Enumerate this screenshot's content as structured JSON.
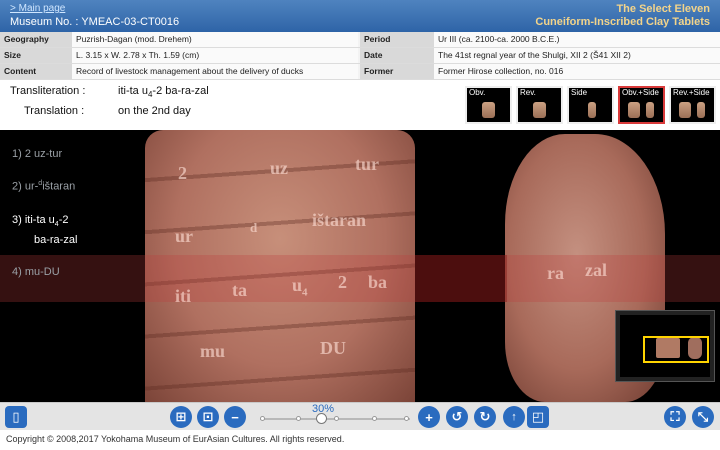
{
  "header": {
    "back_link": "> Main page",
    "museum_no": "Museum No. : YMEAC-03-CT0016",
    "title_line1": "The Select Eleven",
    "title_line2": "Cuneiform-Inscribed Clay Tablets"
  },
  "info": {
    "geography_label": "Geography",
    "geography_value": "Puzrish-Dagan (mod. Drehem)",
    "size_label": "Size",
    "size_value": "L. 3.15 x W. 2.78 x Th. 1.59 (cm)",
    "content_label": "Content",
    "content_value": "Record of livestock management about the delivery of ducks",
    "period_label": "Period",
    "period_value": "Ur III (ca. 2100-ca. 2000 B.C.E.)",
    "date_label": "Date",
    "date_value": "The 41st regnal year of the Shulgi, XII 2 (Š41 XII 2)",
    "collection_label": "Former collection",
    "collection_value": "Former Hirose collection, no. 016"
  },
  "transliteration": {
    "label": "Transliteration :",
    "value_pre": "iti-ta u",
    "value_sub": "4",
    "value_post": "-2 ba-ra-zal"
  },
  "translation": {
    "label": "Translation :",
    "value": "on the 2nd day"
  },
  "thumbs": [
    {
      "label": "Obv."
    },
    {
      "label": "Rev."
    },
    {
      "label": "Side"
    },
    {
      "label": "Obv.+Side"
    },
    {
      "label": "Rev.+Side"
    }
  ],
  "lines": {
    "l1": "1) 2 uz-tur",
    "l2_pre": "2) ur-",
    "l2_sup": "d",
    "l2_post": "ištaran",
    "l3_pre": "3) iti-ta u",
    "l3_sub": "4",
    "l3_post": "-2",
    "l3_cont": "ba-ra-zal",
    "l4": "4) mu-DU"
  },
  "signs": {
    "s_2": "2",
    "s_uz": "uz",
    "s_tur": "tur",
    "s_ur": "ur",
    "s_d": "d",
    "s_istaran": "ištaran",
    "s_iti": "iti",
    "s_ta": "ta",
    "s_u": "u",
    "s_u_sub": "4",
    "s_2b": "2",
    "s_ba": "ba",
    "s_mu": "mu",
    "s_DU": "DU",
    "s_ra": "ra",
    "s_zal": "zal"
  },
  "toolbar": {
    "zoom_label": "30%"
  },
  "footer": {
    "copyright": "Copyright © 2008,2017 Yokohama Museum of EurAsian Cultures. All rights reserved."
  },
  "colors": {
    "header_blue": "#2e64a7",
    "title_gold": "#f3d48a",
    "button_blue": "#2a6bbf",
    "active_thumb_border": "#d93a3a",
    "minimap_frame": "#ffd400"
  }
}
